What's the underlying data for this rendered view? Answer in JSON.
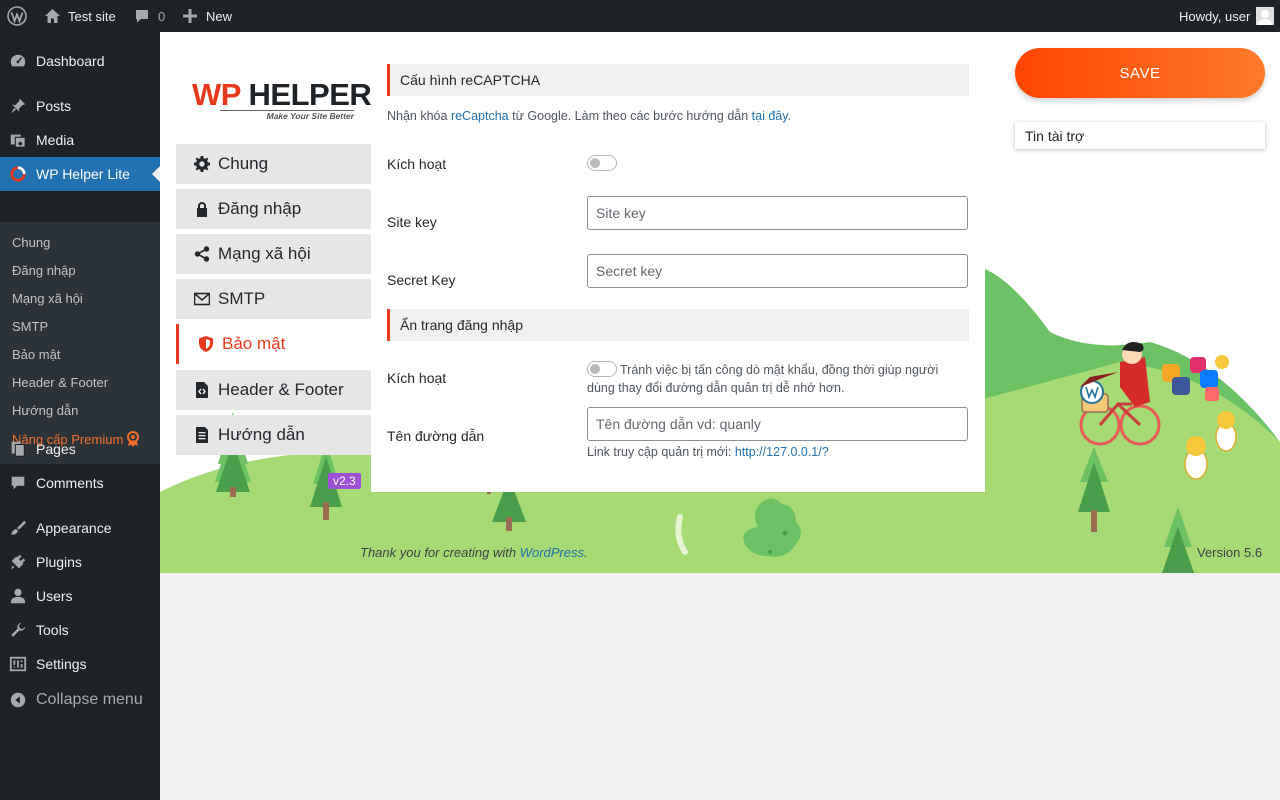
{
  "admin_bar": {
    "site_name": "Test site",
    "comments_count": "0",
    "new_label": "New",
    "greeting": "Howdy, user"
  },
  "sidebar": {
    "items": [
      {
        "label": "Dashboard",
        "icon": "dashboard-icon"
      },
      {
        "label": "Posts",
        "icon": "pin-icon"
      },
      {
        "label": "Media",
        "icon": "media-icon"
      },
      {
        "label": "WP Helper Lite",
        "icon": "helper-icon"
      },
      {
        "label": "Pages",
        "icon": "pages-icon"
      },
      {
        "label": "Comments",
        "icon": "comment-icon"
      },
      {
        "label": "Appearance",
        "icon": "brush-icon"
      },
      {
        "label": "Plugins",
        "icon": "plug-icon"
      },
      {
        "label": "Users",
        "icon": "user-icon"
      },
      {
        "label": "Tools",
        "icon": "wrench-icon"
      },
      {
        "label": "Settings",
        "icon": "settings-icon"
      },
      {
        "label": "Collapse menu",
        "icon": "collapse-icon"
      }
    ],
    "submenu": [
      "Chung",
      "Đăng nhập",
      "Mạng xã hội",
      "SMTP",
      "Bảo mật",
      "Header & Footer",
      "Hướng dẫn",
      "Nâng cấp Premium"
    ]
  },
  "plugin": {
    "logo_main_red": "WP",
    "logo_main_dark": "HELPER",
    "logo_tagline": "Make Your Site Better",
    "version": "v2.3",
    "nav": [
      "Chung",
      "Đăng nhập",
      "Mạng xã hội",
      "SMTP",
      "Bảo mật",
      "Header & Footer",
      "Hướng dẫn"
    ]
  },
  "recaptcha": {
    "heading": "Cấu hình reCAPTCHA",
    "desc_before": "Nhận khóa ",
    "desc_link1": "reCaptcha",
    "desc_middle": " từ Google. Làm theo các bước hướng dẫn ",
    "desc_link2": "tại đây",
    "desc_after": ".",
    "enable_label": "Kích hoạt",
    "site_key_label": "Site key",
    "site_key_placeholder": "Site key",
    "secret_key_label": "Secret Key",
    "secret_key_placeholder": "Secret key"
  },
  "hide_login": {
    "heading": "Ẩn trang đăng nhập",
    "enable_label": "Kích hoạt",
    "enable_hint": "Tránh việc bị tấn công dò mật khẩu, đồng thời giúp người dùng thay đổi đường dẫn quản trị dễ nhớ hơn.",
    "path_label": "Tên đường dẫn",
    "path_placeholder": "Tên đường dẫn vd: quanly",
    "new_link_label": "Link truy cập quản trị mới: ",
    "new_link_url": "http://127.0.0.1/?"
  },
  "right": {
    "save_label": "SAVE",
    "sponsor_label": "Tin tài trợ"
  },
  "footer": {
    "thanks_before": "Thank you for creating with ",
    "thanks_link": "WordPress",
    "thanks_after": ".",
    "version": "Version 5.6"
  },
  "colors": {
    "accent_red": "#e8391d",
    "save_start": "#ff4500",
    "save_end": "#ff7a2a",
    "wp_blue": "#2271b1",
    "hill_green": "#a6da74",
    "premium_orange": "#f56e28"
  }
}
